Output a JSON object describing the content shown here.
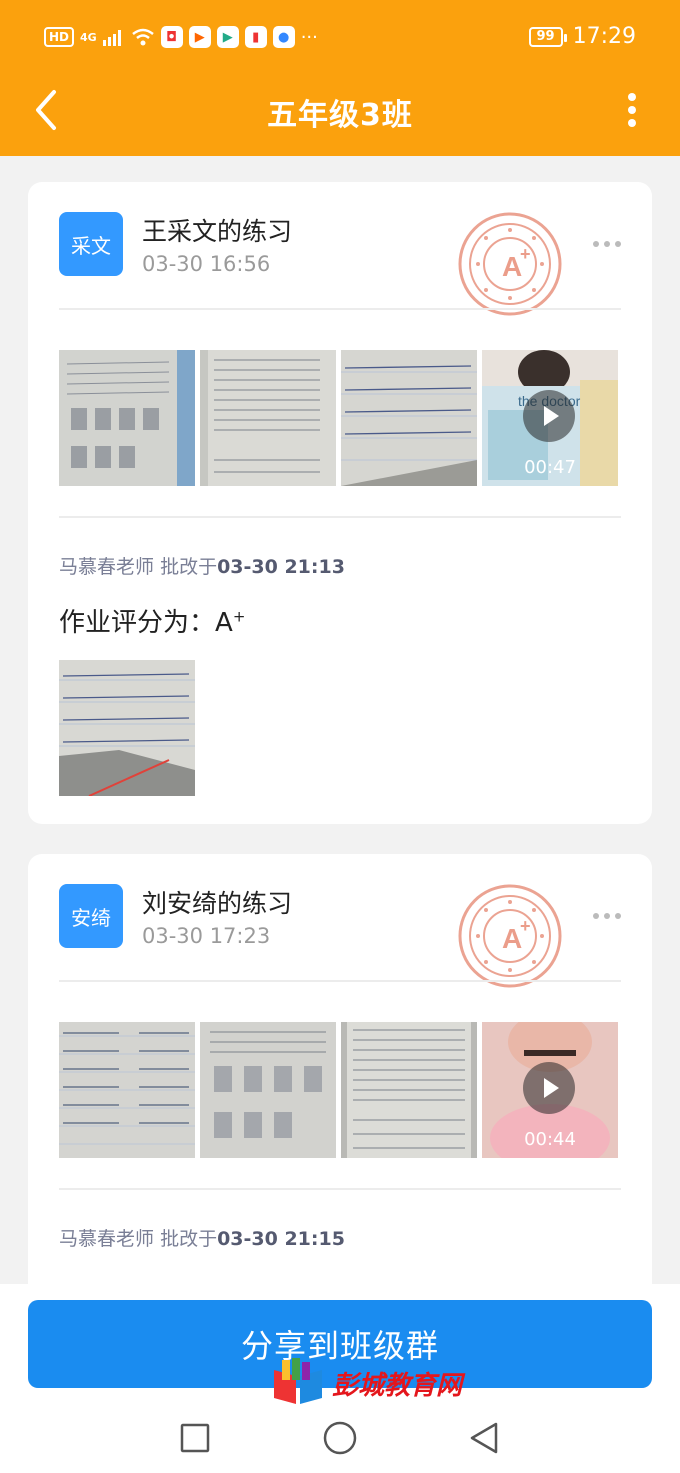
{
  "status_bar": {
    "left_badges": [
      "HD",
      "4G"
    ],
    "more_glyph": "···",
    "battery": "99",
    "time": "17:29"
  },
  "header": {
    "title": "五年级3班",
    "back_icon": "chevron-left-icon",
    "more_icon": "vertical-dots-icon"
  },
  "submissions": [
    {
      "avatar_text": "采文",
      "name": "王采文的练习",
      "time": "03-30 16:56",
      "stamp_icon": "a-plus-stamp-icon",
      "video_duration": "00:47",
      "teacher": "马慕春老师",
      "action": "批改于",
      "corrected_time": "03-30 21:13",
      "grade_label": "作业评分为：",
      "grade": "A",
      "grade_sup": "+"
    },
    {
      "avatar_text": "安绮",
      "name": "刘安绮的练习",
      "time": "03-30 17:23",
      "stamp_icon": "a-plus-stamp-icon",
      "video_duration": "00:44",
      "teacher": "马慕春老师",
      "action": "批改于",
      "corrected_time": "03-30 21:15"
    }
  ],
  "footer": {
    "share_label": "分享到班级群",
    "watermark": "彭城教育网"
  },
  "colors": {
    "header": "#fba10d",
    "accent": "#1a8cf0",
    "avatar": "#3399ff",
    "stamp": "#e88a7a"
  }
}
